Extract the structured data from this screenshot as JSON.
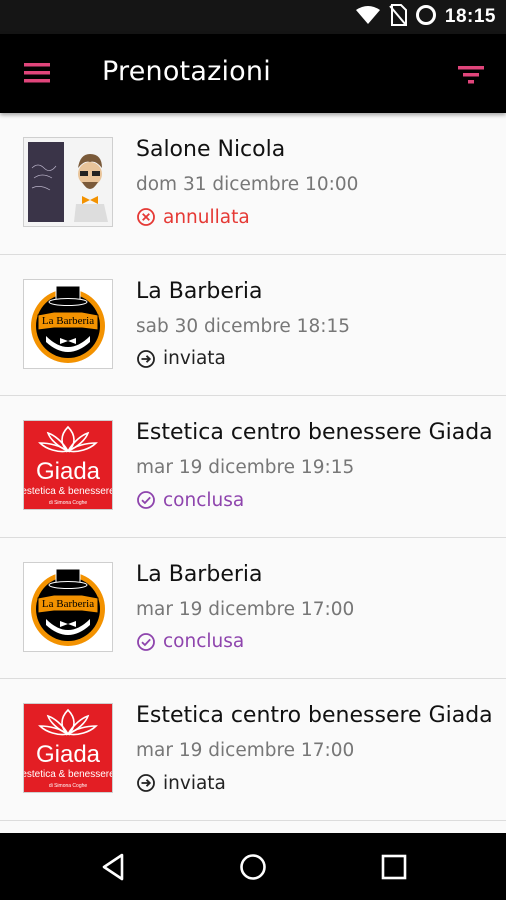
{
  "status_bar": {
    "time": "18:15",
    "icons": [
      "wifi-icon",
      "no-sim-icon",
      "sync-icon"
    ]
  },
  "app_bar": {
    "title": "Prenotazioni",
    "menu_icon": "hamburger-menu-icon",
    "filter_icon": "filter-icon",
    "accent_color": "#e0457b"
  },
  "bookings": [
    {
      "name": "Salone Nicola",
      "date": "dom 31 dicembre 10:00",
      "status": "annullata",
      "status_type": "cancelled",
      "logo": "salone-nicola"
    },
    {
      "name": "La Barberia",
      "date": "sab 30 dicembre 18:15",
      "status": "inviata",
      "status_type": "sent",
      "logo": "la-barberia"
    },
    {
      "name": "Estetica centro benessere Giada",
      "date": "mar 19 dicembre 19:15",
      "status": "conclusa",
      "status_type": "completed",
      "logo": "giada"
    },
    {
      "name": "La Barberia",
      "date": "mar 19 dicembre 17:00",
      "status": "conclusa",
      "status_type": "completed",
      "logo": "la-barberia"
    },
    {
      "name": "Estetica centro benessere Giada",
      "date": "mar 19 dicembre 17:00",
      "status": "inviata",
      "status_type": "sent",
      "logo": "giada"
    }
  ],
  "logos": {
    "barberia_text": "La Barberia",
    "giada_text": "Giada",
    "giada_subtext": "estetica & benessere",
    "giada_small": "di Simona Coghe"
  },
  "status_colors": {
    "cancelled": "#e53935",
    "sent": "#222222",
    "completed": "#8e44ad"
  },
  "nav_bar": {
    "icons": [
      "back-icon",
      "home-icon",
      "recents-icon"
    ]
  }
}
